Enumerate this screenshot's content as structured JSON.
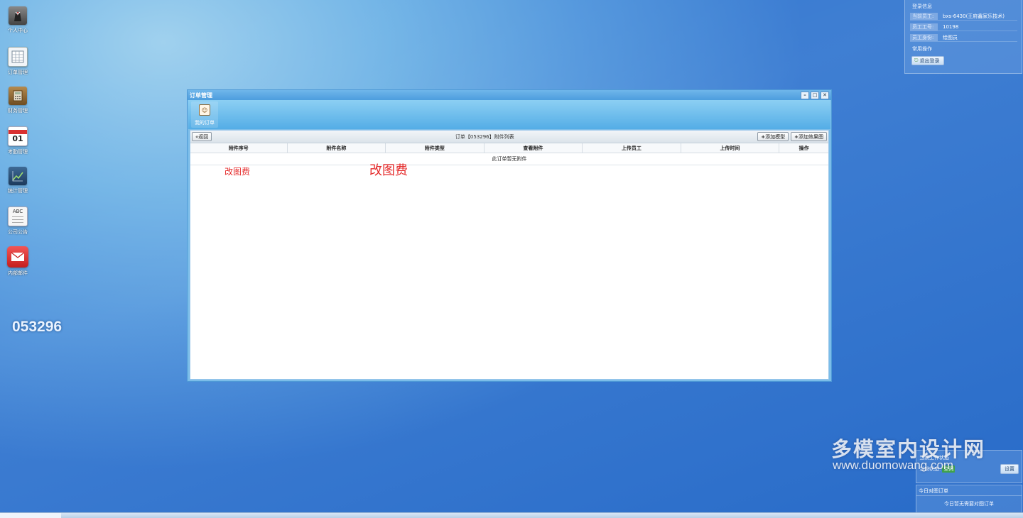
{
  "desktop": {
    "icons": [
      {
        "label": "个人中心",
        "icon": "person-suit-icon",
        "color": "#6b6b6b"
      },
      {
        "label": "订单管理",
        "icon": "spreadsheet-icon",
        "color": "#e9eef3"
      },
      {
        "label": "财务管理",
        "icon": "calculator-icon",
        "color": "#8a6a3a"
      },
      {
        "label": "考勤管理",
        "icon": "calendar-icon",
        "color": "#ffffff"
      },
      {
        "label": "统计管理",
        "icon": "chart-icon",
        "color": "#2d4e72"
      },
      {
        "label": "公司公告",
        "icon": "abc-document-icon",
        "color": "#f4f4f4"
      },
      {
        "label": "内部邮件",
        "icon": "mail-icon",
        "color": "#e53535"
      }
    ],
    "calendar_day": "01",
    "abc_text": "ABC",
    "order_no_big": "053296"
  },
  "login_info": {
    "section_title": "登录信息",
    "rows": [
      {
        "key": "当前员工:",
        "value": "bxs-6430(王府鑫家乐技术)"
      },
      {
        "key": "员工工号:",
        "value": "10198"
      },
      {
        "key": "员工身份:",
        "value": "绘图员"
      }
    ],
    "common_title": "常用操作",
    "logout_label": "退出登录"
  },
  "window": {
    "title": "订单管理",
    "toolbar_item": "我的订单",
    "back_label": "返回",
    "list_title": "订单【053296】附件列表",
    "add_model_label": "添加模型",
    "add_render_label": "添加效果图",
    "columns": [
      "附件序号",
      "附件名称",
      "附件类型",
      "查看附件",
      "上传员工",
      "上传时间",
      "操作"
    ],
    "empty_message": "此订单暂无附件",
    "red_text_small": "改图费",
    "red_text_big": "改图费"
  },
  "watermark": {
    "cn": "多模室内设计网",
    "en": "www.duomowang.com"
  },
  "work_status": {
    "title": "当前工作状态",
    "status_label": "当前状态:",
    "status_value": "空闲",
    "set_label": "设置"
  },
  "today": {
    "title": "今日对图订单",
    "message": "今日暂无需要对图订单"
  }
}
